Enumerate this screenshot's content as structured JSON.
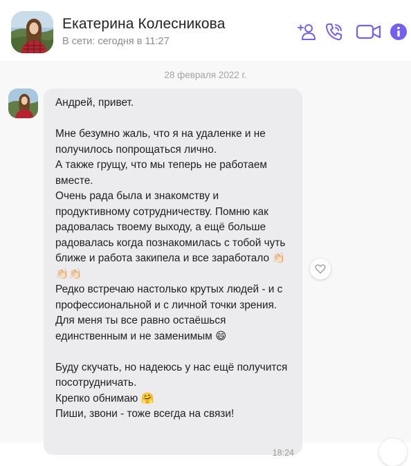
{
  "header": {
    "name": "Екатерина Колесникова",
    "status": "В сети: сегодня в 11:27",
    "accent": "#7360f2",
    "icons": [
      "add-contact-icon",
      "call-icon",
      "video-call-icon",
      "info-icon"
    ]
  },
  "chat": {
    "date": "28 февраля 2022 г.",
    "message": {
      "text": "Андрей, привет.\n\nМне безумно жаль, что я на удаленке и не получилось попрощаться лично.\nА также грущу, что мы теперь не работаем вместе.\nОчень рада была и знакомству и продуктивному сотрудничеству. Помню как радовалась твоему выходу, а ещё больше радовалась когда познакомилась с тобой чуть ближе и работа закипела и все заработало 👏🏻👏🏻👏🏻\nРедко встречаю настолько крутых людей - и с профессиональной и с личной точки зрения. Для меня ты все равно остаёшься единственным и не заменимым 😄\n\nБуду скучать, но надеюсь у нас ещё получится посотрудничать.\nКрепко обнимаю 🤗\nПиши, звони - тоже всегда на связи!",
      "time": "18:24"
    }
  }
}
